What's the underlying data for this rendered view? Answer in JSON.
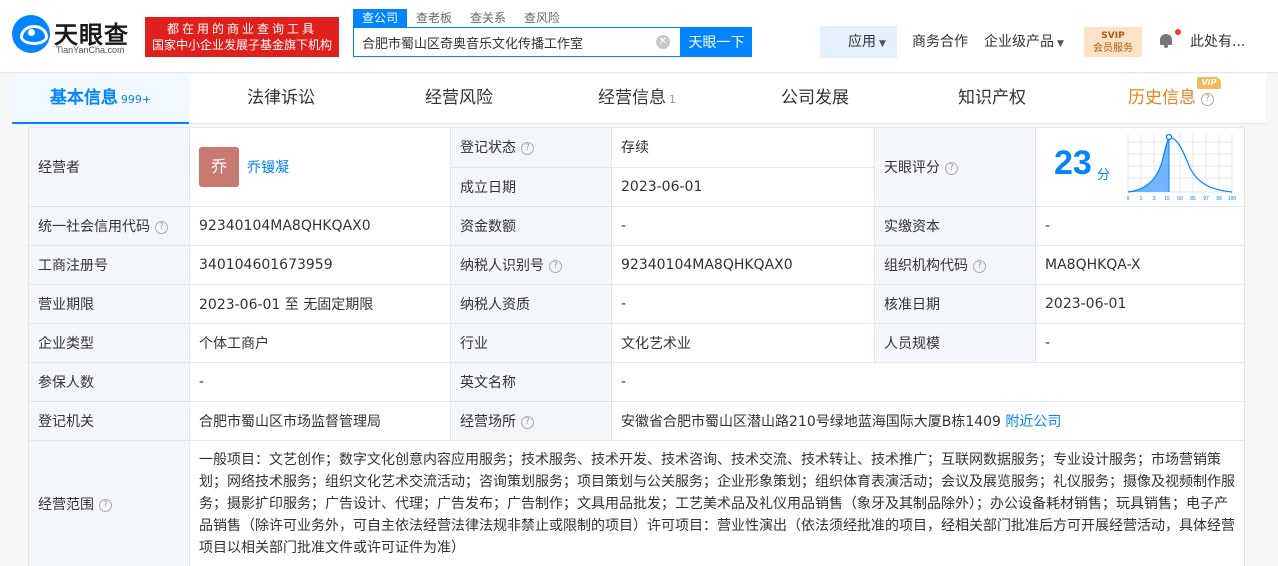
{
  "header": {
    "logo_cn": "天眼查",
    "logo_en": "TianYanCha.com",
    "slogan_line1": "都在用的商业查询工具",
    "slogan_line2": "国家中小企业发展子基金旗下机构",
    "search_tabs": [
      "查公司",
      "查老板",
      "查关系",
      "查风险"
    ],
    "search_value": "合肥市蜀山区奇奥音乐文化传播工作室",
    "search_button": "天眼一下",
    "nav_apps": "应用",
    "nav_business": "商务合作",
    "nav_enterprise": "企业级产品",
    "vip_line1": "SVIP",
    "vip_line2": "会员服务",
    "user_name": "此处有..."
  },
  "tabs": [
    {
      "label": "基本信息",
      "count": "999+"
    },
    {
      "label": "法律诉讼"
    },
    {
      "label": "经营风险"
    },
    {
      "label": "经营信息",
      "count": "1"
    },
    {
      "label": "公司发展"
    },
    {
      "label": "知识产权"
    },
    {
      "label": "历史信息",
      "tag": "VIP"
    }
  ],
  "info": {
    "operator_label": "经营者",
    "operator_avatar": "乔",
    "operator_name": "乔镘凝",
    "reg_status_label": "登记状态",
    "reg_status": "存续",
    "found_date_label": "成立日期",
    "found_date": "2023-06-01",
    "score_label": "天眼评分",
    "score": "23",
    "score_unit": "分",
    "score_ticks": [
      "0",
      "1",
      "3",
      "15",
      "50",
      "85",
      "97",
      "99",
      "100"
    ],
    "credit_code_label": "统一社会信用代码",
    "credit_code": "92340104MA8QHKQAX0",
    "capital_label": "资金数额",
    "capital": "-",
    "paid_capital_label": "实缴资本",
    "paid_capital": "-",
    "reg_no_label": "工商注册号",
    "reg_no": "340104601673959",
    "taxpayer_id_label": "纳税人识别号",
    "taxpayer_id": "92340104MA8QHKQAX0",
    "org_code_label": "组织机构代码",
    "org_code": "MA8QHKQA-X",
    "term_label": "营业期限",
    "term": "2023-06-01 至 无固定期限",
    "taxpayer_qual_label": "纳税人资质",
    "taxpayer_qual": "-",
    "approve_date_label": "核准日期",
    "approve_date": "2023-06-01",
    "type_label": "企业类型",
    "type": "个体工商户",
    "industry_label": "行业",
    "industry": "文化艺术业",
    "staff_label": "人员规模",
    "staff": "-",
    "insured_label": "参保人数",
    "insured": "-",
    "en_name_label": "英文名称",
    "en_name": "-",
    "authority_label": "登记机关",
    "authority": "合肥市蜀山区市场监督管理局",
    "address_label": "经营场所",
    "address": "安徽省合肥市蜀山区潜山路210号绿地蓝海国际大厦B栋1409",
    "nearby_link": "附近公司",
    "scope_label": "经营范围",
    "scope": "一般项目：文艺创作；数字文化创意内容应用服务；技术服务、技术开发、技术咨询、技术交流、技术转让、技术推广；互联网数据服务；专业设计服务；市场营销策划；网络技术服务；组织文化艺术交流活动；咨询策划服务；项目策划与公关服务；企业形象策划；组织体育表演活动；会议及展览服务；礼仪服务；摄像及视频制作服务；摄影扩印服务；广告设计、代理；广告发布；广告制作；文具用品批发；工艺美术品及礼仪用品销售（象牙及其制品除外）；办公设备耗材销售；玩具销售；电子产品销售（除许可业务外，可自主依法经营法律法规非禁止或限制的项目）许可项目：营业性演出（依法须经批准的项目，经相关部门批准后方可开展经营活动，具体经营项目以相关部门批准文件或许可证件为准）"
  },
  "colors": {
    "brand_blue": "#0084ff",
    "slogan_red": "#e0201c",
    "status_green": "#27ae4f",
    "history_orange": "#e6841f"
  }
}
